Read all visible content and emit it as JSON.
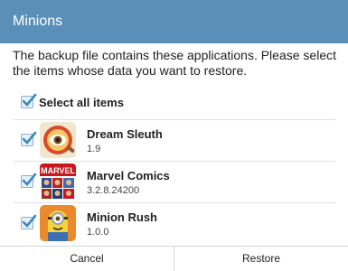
{
  "dialog": {
    "title": "Minions",
    "message": "The backup file contains these applications. Please select the items whose data you want to restore."
  },
  "select_all": {
    "label": "Select all items",
    "checked": true
  },
  "apps": [
    {
      "name": "Dream Sleuth",
      "version": "1.9",
      "checked": true,
      "icon": "dream-sleuth-icon"
    },
    {
      "name": "Marvel Comics",
      "version": "3.2.8.24200",
      "checked": true,
      "icon": "marvel-comics-icon",
      "icon_text": "MARVEL"
    },
    {
      "name": "Minion Rush",
      "version": "1.0.0",
      "checked": true,
      "icon": "minion-rush-icon"
    }
  ],
  "buttons": {
    "cancel": "Cancel",
    "restore": "Restore"
  },
  "colors": {
    "title_bar": "#5a8fba",
    "check": "#3a86c8",
    "marvel_red": "#c8171d"
  }
}
